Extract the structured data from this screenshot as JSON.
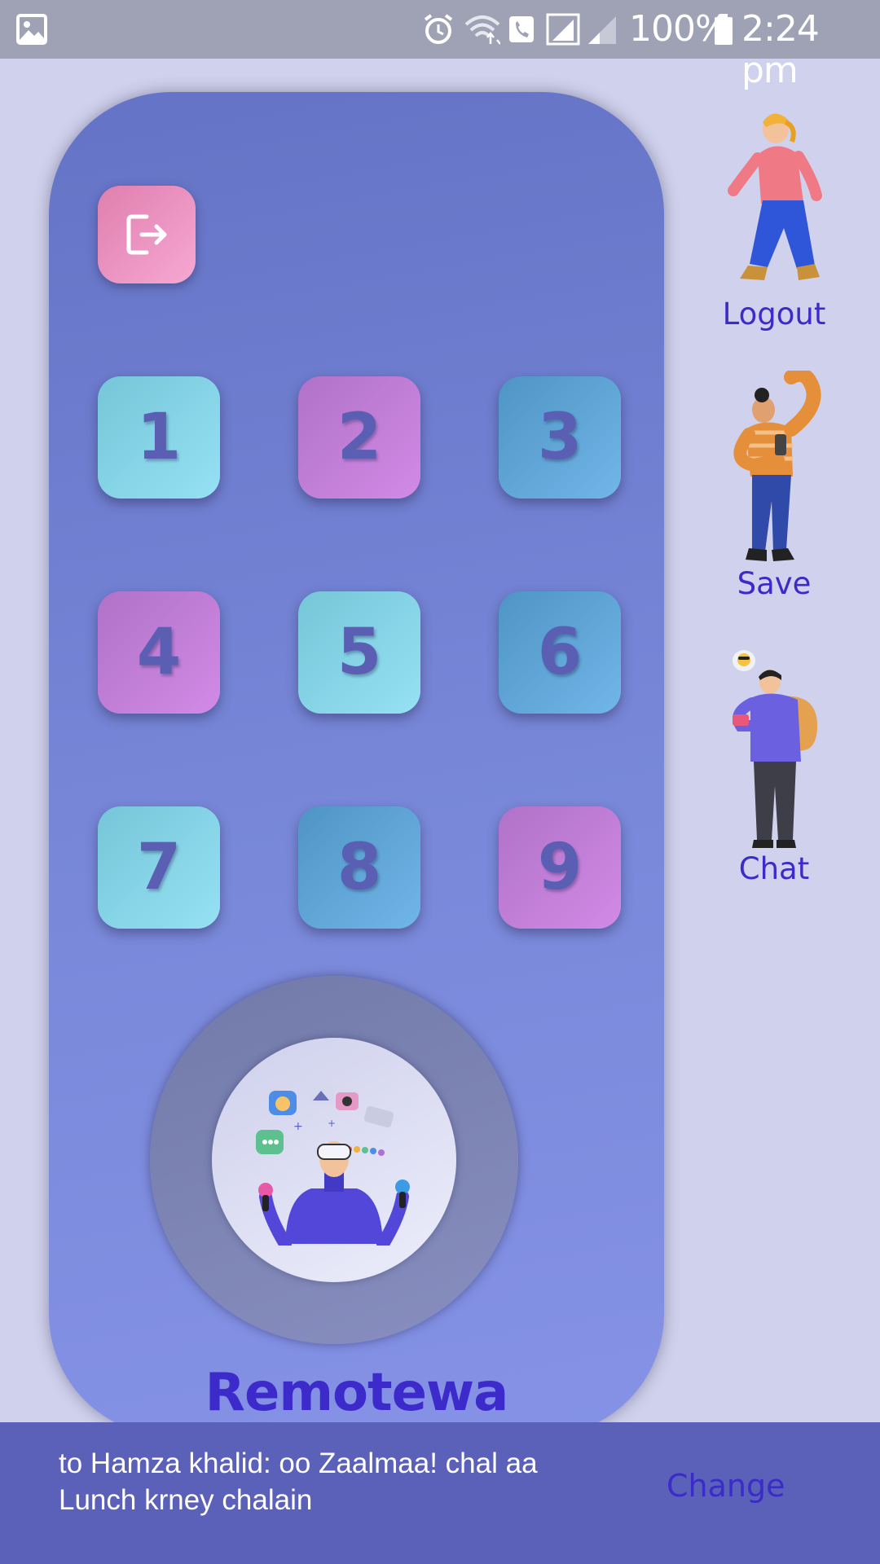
{
  "status_bar": {
    "icons": [
      "gallery-icon",
      "alarm-icon",
      "wifi-icon",
      "wifi-calling-icon",
      "signal-icon",
      "signal-icon-2",
      "battery-icon"
    ],
    "battery_percent": "100%",
    "time": "2:24 pm"
  },
  "remote": {
    "logout_icon": "logout-icon",
    "keys": [
      "1",
      "2",
      "3",
      "4",
      "5",
      "6",
      "7",
      "8",
      "9"
    ],
    "brand": "Remotewa",
    "colors": {
      "cyan": "#8ad7ec",
      "purple": "#c17fd8",
      "blue": "#5fa5d7",
      "pink": "#ec95c2",
      "body": "#6f7dcf"
    }
  },
  "side_menu": {
    "logout": "Logout",
    "save": "Save",
    "chat": "Chat"
  },
  "snackbar": {
    "message": "to Hamza khalid: oo Zaalmaa! chal aa Lunch krney chalain",
    "action": "Change"
  }
}
